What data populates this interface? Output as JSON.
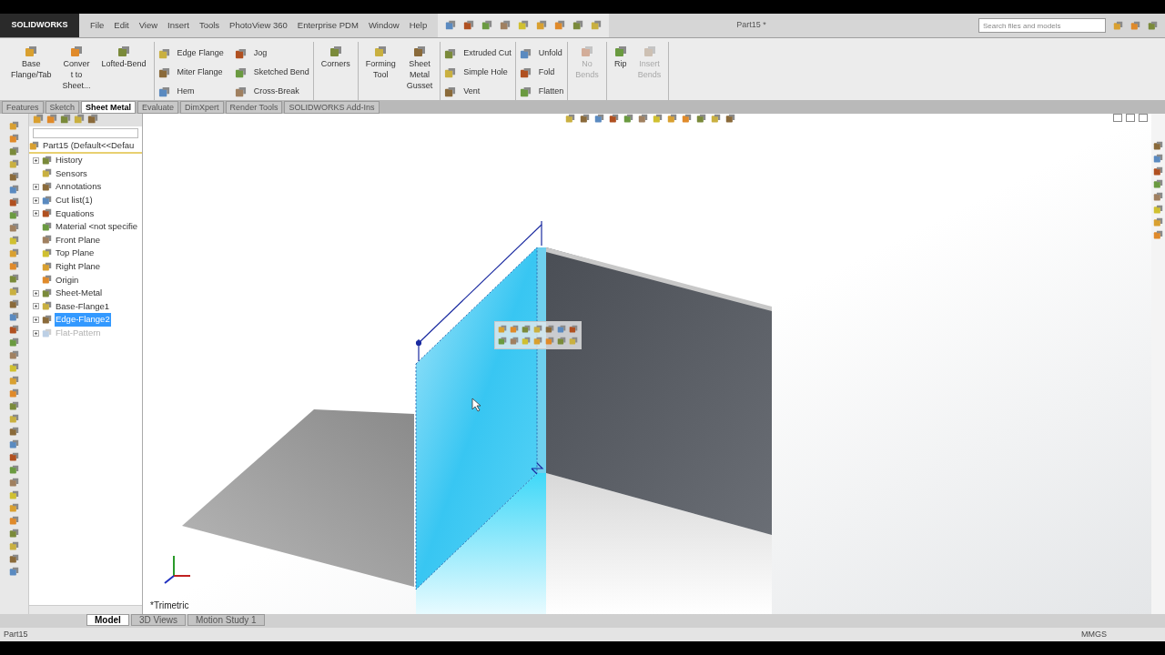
{
  "app": {
    "logo": "SOLIDWORKS"
  },
  "menu": [
    "File",
    "Edit",
    "View",
    "Insert",
    "Tools",
    "PhotoView 360",
    "Enterprise PDM",
    "Window",
    "Help"
  ],
  "window": {
    "title": "Part15 *"
  },
  "search": {
    "placeholder": "Search files and models"
  },
  "ribbon": {
    "groups": [
      {
        "kind": "large",
        "items": [
          {
            "label": "Base\nFlange/Tab",
            "disabled": false
          },
          {
            "label": "Conver\nt to\nSheet...",
            "disabled": false
          },
          {
            "label": "Lofted-Bend",
            "disabled": false
          }
        ]
      },
      {
        "kind": "small",
        "items": [
          {
            "label": "Edge Flange",
            "disabled": false
          },
          {
            "label": "Miter Flange",
            "disabled": false
          },
          {
            "label": "Hem",
            "disabled": false
          },
          {
            "label": "Jog",
            "disabled": false
          },
          {
            "label": "Sketched Bend",
            "disabled": false
          },
          {
            "label": "Cross-Break",
            "disabled": false
          }
        ]
      },
      {
        "kind": "large",
        "items": [
          {
            "label": "Corners",
            "disabled": false
          }
        ]
      },
      {
        "kind": "large",
        "items": [
          {
            "label": "Forming\nTool",
            "disabled": false
          },
          {
            "label": "Sheet\nMetal\nGusset",
            "disabled": false
          }
        ]
      },
      {
        "kind": "small",
        "items": [
          {
            "label": "Extruded Cut",
            "disabled": false
          },
          {
            "label": "Simple Hole",
            "disabled": false
          },
          {
            "label": "Vent",
            "disabled": false
          }
        ]
      },
      {
        "kind": "small",
        "items": [
          {
            "label": "Unfold",
            "disabled": false
          },
          {
            "label": "Fold",
            "disabled": false
          },
          {
            "label": "Flatten",
            "disabled": false
          }
        ]
      },
      {
        "kind": "large",
        "items": [
          {
            "label": "No\nBends",
            "disabled": true
          }
        ]
      },
      {
        "kind": "large",
        "items": [
          {
            "label": "Rip",
            "disabled": false
          },
          {
            "label": "Insert\nBends",
            "disabled": true
          }
        ]
      }
    ]
  },
  "tabs": [
    {
      "label": "Features",
      "selected": false
    },
    {
      "label": "Sketch",
      "selected": false
    },
    {
      "label": "Sheet Metal",
      "selected": true
    },
    {
      "label": "Evaluate",
      "selected": false
    },
    {
      "label": "DimXpert",
      "selected": false
    },
    {
      "label": "Render Tools",
      "selected": false
    },
    {
      "label": "SOLIDWORKS Add-Ins",
      "selected": false
    }
  ],
  "tree": {
    "root": "Part15  (Default<<Defau",
    "items": [
      {
        "label": "History",
        "expandable": true,
        "selected": false,
        "disabled": false
      },
      {
        "label": "Sensors",
        "expandable": false,
        "selected": false,
        "disabled": false
      },
      {
        "label": "Annotations",
        "expandable": true,
        "selected": false,
        "disabled": false
      },
      {
        "label": "Cut list(1)",
        "expandable": true,
        "selected": false,
        "disabled": false
      },
      {
        "label": "Equations",
        "expandable": true,
        "selected": false,
        "disabled": false
      },
      {
        "label": "Material <not specifie",
        "expandable": false,
        "selected": false,
        "disabled": false
      },
      {
        "label": "Front Plane",
        "expandable": false,
        "selected": false,
        "disabled": false
      },
      {
        "label": "Top Plane",
        "expandable": false,
        "selected": false,
        "disabled": false
      },
      {
        "label": "Right Plane",
        "expandable": false,
        "selected": false,
        "disabled": false
      },
      {
        "label": "Origin",
        "expandable": false,
        "selected": false,
        "disabled": false
      },
      {
        "label": "Sheet-Metal",
        "expandable": true,
        "selected": false,
        "disabled": false
      },
      {
        "label": "Base-Flange1",
        "expandable": true,
        "selected": false,
        "disabled": false
      },
      {
        "label": "Edge-Flange2",
        "expandable": true,
        "selected": true,
        "disabled": false
      },
      {
        "label": "Flat-Pattern",
        "expandable": true,
        "selected": false,
        "disabled": true
      }
    ]
  },
  "viewport": {
    "view_name": "*Trimetric"
  },
  "bottom_tabs": [
    {
      "label": "Model",
      "selected": true
    },
    {
      "label": "3D Views",
      "selected": false
    },
    {
      "label": "Motion Study 1",
      "selected": false
    }
  ],
  "status_bar": {
    "document": "Part15",
    "units": "MMGS"
  }
}
